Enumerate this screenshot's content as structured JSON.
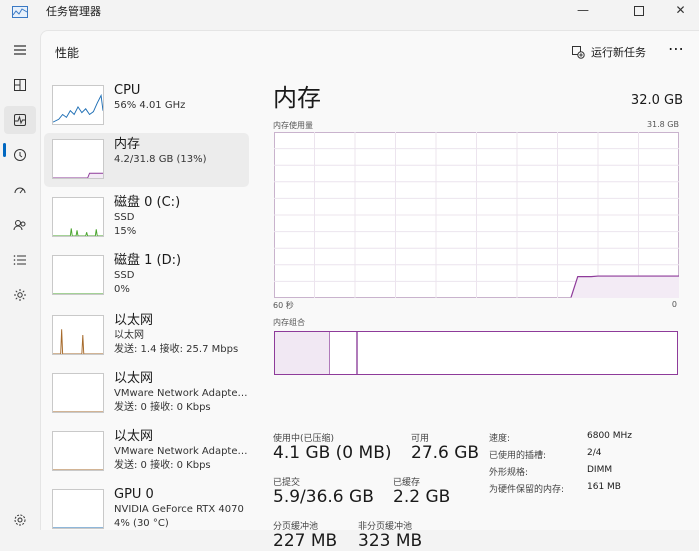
{
  "window": {
    "title": "任务管理器",
    "min": "—",
    "close": "✕"
  },
  "header": {
    "title": "性能",
    "run_task": "运行新任务",
    "more": "⋯"
  },
  "rail": {
    "items": [
      "menu-icon",
      "processes-icon",
      "performance-icon",
      "app-history-icon",
      "startup-icon",
      "users-icon",
      "details-icon",
      "services-icon",
      "settings-icon"
    ],
    "active": "performance-icon"
  },
  "devices": [
    {
      "name": "CPU",
      "lines": [
        "56%  4.01 GHz"
      ],
      "color": "#1f6fb5"
    },
    {
      "name": "内存",
      "lines": [
        "4.2/31.8 GB (13%)"
      ],
      "color": "#8e3b9a"
    },
    {
      "name": "磁盘 0 (C:)",
      "lines": [
        "SSD",
        "15%"
      ],
      "color": "#4aa52e"
    },
    {
      "name": "磁盘 1 (D:)",
      "lines": [
        "SSD",
        "0%"
      ],
      "color": "#4aa52e"
    },
    {
      "name": "以太网",
      "lines": [
        "以太网",
        "发送: 1.4 接收: 25.7 Mbps"
      ],
      "color": "#a66a2b"
    },
    {
      "name": "以太网",
      "lines": [
        "VMware Network Adapte…",
        "发送: 0 接收: 0 Kbps"
      ],
      "color": "#a66a2b"
    },
    {
      "name": "以太网",
      "lines": [
        "VMware Network Adapte…",
        "发送: 0 接收: 0 Kbps"
      ],
      "color": "#a66a2b"
    },
    {
      "name": "GPU 0",
      "lines": [
        "NVIDIA GeForce RTX 4070",
        "4% (30 °C)"
      ],
      "color": "#1f6fb5"
    }
  ],
  "memory": {
    "title": "内存",
    "total": "32.0 GB",
    "usage_label": "内存使用量",
    "usage_max": "31.8 GB",
    "axis_left": "60 秒",
    "axis_right": "0",
    "composition_label": "内存组合",
    "stats": {
      "in_use_label": "使用中(已压缩)",
      "in_use_value": "4.1 GB (0 MB)",
      "available_label": "可用",
      "available_value": "27.6 GB",
      "committed_label": "已提交",
      "committed_value": "5.9/36.6 GB",
      "cached_label": "已缓存",
      "cached_value": "2.2 GB",
      "paged_label": "分页缓冲池",
      "paged_value": "227 MB",
      "nonpaged_label": "非分页缓冲池",
      "nonpaged_value": "323 MB"
    },
    "specs": [
      {
        "label": "速度:",
        "value": "6800 MHz"
      },
      {
        "label": "已使用的插槽:",
        "value": "2/4"
      },
      {
        "label": "外形规格:",
        "value": "DIMM"
      },
      {
        "label": "为硬件保留的内存:",
        "value": "161 MB"
      }
    ]
  },
  "chart_data": {
    "type": "area",
    "title": "内存使用量",
    "xlabel": "",
    "ylabel": "",
    "xlim": [
      60,
      0
    ],
    "ylim": [
      0,
      31.8
    ],
    "series": [
      {
        "values": [
          null,
          null,
          null,
          null,
          null,
          null,
          null,
          null,
          null,
          null,
          null,
          null,
          null,
          null,
          null,
          null,
          null,
          null,
          null,
          null,
          null,
          null,
          null,
          null,
          null,
          null,
          null,
          null,
          null,
          null,
          null,
          null,
          null,
          null,
          null,
          null,
          null,
          null,
          null,
          null,
          null,
          null,
          null,
          null,
          0.1,
          4.1,
          4.1,
          4.1,
          4.2,
          4.2,
          4.2,
          4.2,
          4.2,
          4.2,
          4.2,
          4.2,
          4.2,
          4.2,
          4.2,
          4.2,
          4.2
        ]
      }
    ],
    "grid": true
  }
}
